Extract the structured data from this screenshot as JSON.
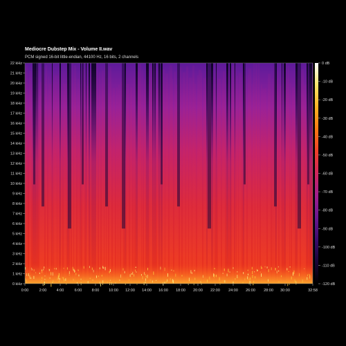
{
  "header": {
    "title": "Mediocre Dubstep Mix - Volume II.wav",
    "subtitle": "PCM signed 16-bit little-endian, 44100 Hz, 16 bits, 2 channels"
  },
  "chart_data": {
    "type": "heatmap",
    "title": "Mediocre Dubstep Mix - Volume II.wav",
    "subtitle": "PCM signed 16-bit little-endian, 44100 Hz, 16 bits, 2 channels",
    "x_axis": {
      "ticks": [
        "0:00",
        "2:00",
        "4:00",
        "6:00",
        "8:00",
        "10:00",
        "12:00",
        "14:00",
        "16:00",
        "18:00",
        "20:00",
        "22:00",
        "24:00",
        "26:00",
        "28:00",
        "30:00",
        "32:58"
      ],
      "range_seconds": [
        0,
        1978
      ]
    },
    "y_axis": {
      "ticks": [
        "0 kHz",
        "1 kHz",
        "2 kHz",
        "3 kHz",
        "4 kHz",
        "5 kHz",
        "6 kHz",
        "7 kHz",
        "8 kHz",
        "9 kHz",
        "10 kHz",
        "11 kHz",
        "12 kHz",
        "13 kHz",
        "14 kHz",
        "15 kHz",
        "16 kHz",
        "17 kHz",
        "18 kHz",
        "19 kHz",
        "20 kHz",
        "21 kHz",
        "22 kHz"
      ],
      "range_khz": [
        0,
        22
      ]
    },
    "colorbar": {
      "ticks": [
        "0 dB",
        "-10 dB",
        "-20 dB",
        "-30 dB",
        "-40 dB",
        "-50 dB",
        "-60 dB",
        "-70 dB",
        "-80 dB",
        "-90 dB",
        "-100 dB",
        "-110 dB",
        "-120 dB"
      ],
      "range_db": [
        -120,
        0
      ],
      "colormap": [
        "#000000",
        "#1a0538",
        "#3a0c6e",
        "#6a1890",
        "#a01e8e",
        "#d0265c",
        "#f0402a",
        "#fa7a14",
        "#fcb424",
        "#fbe66a",
        "#ffffff"
      ]
    },
    "grid": false
  }
}
